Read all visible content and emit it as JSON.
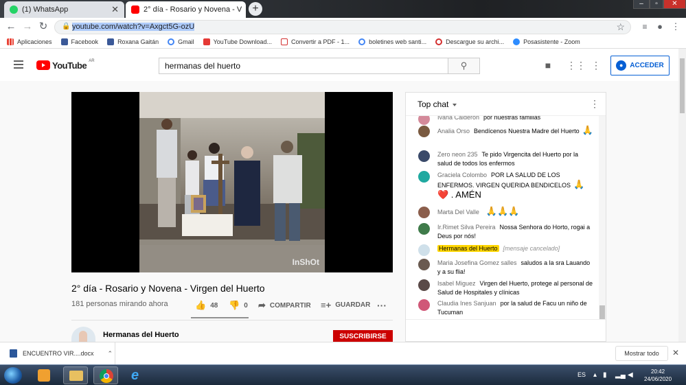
{
  "browser": {
    "tabs": [
      {
        "label": "(1) WhatsApp",
        "active": false
      },
      {
        "label": "2° día - Rosario y Novena - V",
        "active": true
      }
    ],
    "url": "youtube.com/watch?v=Axgct5G-ozU"
  },
  "bookmarks": [
    {
      "label": "Aplicaciones",
      "icon": "apps-grid-icon",
      "color": "#e94235"
    },
    {
      "label": "Facebook",
      "icon": "facebook-icon",
      "color": "#3b5998"
    },
    {
      "label": "Roxana Gaitán",
      "icon": "facebook-icon",
      "color": "#3b5998"
    },
    {
      "label": "Gmail",
      "icon": "google-icon",
      "color": "#4285f4"
    },
    {
      "label": "YouTube Download...",
      "icon": "download-icon",
      "color": "#e53935"
    },
    {
      "label": "Convertir a PDF - 1...",
      "icon": "pdf-icon",
      "color": "#d32f2f"
    },
    {
      "label": "boletines web santi...",
      "icon": "google-icon",
      "color": "#4285f4"
    },
    {
      "label": "Descargue su archi...",
      "icon": "no-icon",
      "color": "#d32f2f"
    },
    {
      "label": "Posasistente - Zoom",
      "icon": "zoom-icon",
      "color": "#2d8cff"
    }
  ],
  "youtube": {
    "logo_text": "YouTube",
    "country": "AR",
    "search_value": "hermanas del huerto",
    "signin_label": "ACCEDER"
  },
  "video": {
    "title": "2° día - Rosario y Novena - Virgen del Huerto",
    "viewers": "181 personas mirando ahora",
    "likes": "48",
    "dislikes": "0",
    "like_ratio": 1.0,
    "share_label": "COMPARTIR",
    "save_label": "GUARDAR",
    "watermark": "InShOt"
  },
  "channel": {
    "name": "Hermanas del Huerto",
    "subscribe_label": "SUSCRIBIRSE"
  },
  "chat": {
    "title": "Top chat",
    "messages": [
      {
        "author": "Ivana Calderón",
        "text": "por nuestras familias",
        "emoji": "",
        "avatar_color": "#d48a9a",
        "owner": false
      },
      {
        "author": "Analia Orso",
        "text": "Bendícenos Nuestra Madre del Huerto",
        "emoji": "🙏",
        "avatar_color": "#7a5a40",
        "owner": false
      },
      {
        "author": "Zero neon 235",
        "text": "Te pido Virgencita del Huerto por la salud de todos los enfermos",
        "emoji": "",
        "avatar_color": "#3a4a6a",
        "owner": false
      },
      {
        "author": "Graciela Colombo",
        "text": "POR LA SALUD DE LOS ENFERMOS. VIRGEN QUERIDA BENDICELOS",
        "emoji": "🙏 ❤️ . AMÉN",
        "avatar_color": "#1fa9a0",
        "owner": false
      },
      {
        "author": "Marta Del Valle",
        "text": "",
        "emoji": "🙏🙏🙏",
        "avatar_color": "#8b5e4c",
        "owner": false
      },
      {
        "author": "Ir.Rimet Silva Pereira",
        "text": "Nossa Senhora do Horto, rogai a Deus por nós!",
        "emoji": "",
        "avatar_color": "#3f7b4a",
        "owner": false
      },
      {
        "author": "Hermanas del Huerto",
        "text": "[mensaje cancelado]",
        "emoji": "",
        "avatar_color": "#cfe0ea",
        "owner": true
      },
      {
        "author": "Maria Josefina Gomez salles",
        "text": "saludos a la sra Lauando y a su flia!",
        "emoji": "",
        "avatar_color": "#6a5a50",
        "owner": false
      },
      {
        "author": "Isabel Miguez",
        "text": "Virgen del Huerto, protege al personal de Salud de Hospitales y clínicas",
        "emoji": "",
        "avatar_color": "#5a4a48",
        "owner": false
      },
      {
        "author": "Claudia Ines Sanjuan",
        "text": "por la salud de Facu un niño de Tucuman",
        "emoji": "",
        "avatar_color": "#d05878",
        "owner": false
      }
    ]
  },
  "downloads": {
    "file_name": "ENCUENTRO VIR....docx",
    "show_all_label": "Mostrar todo"
  },
  "taskbar": {
    "language": "ES",
    "time": "20:42",
    "date": "24/06/2020"
  }
}
